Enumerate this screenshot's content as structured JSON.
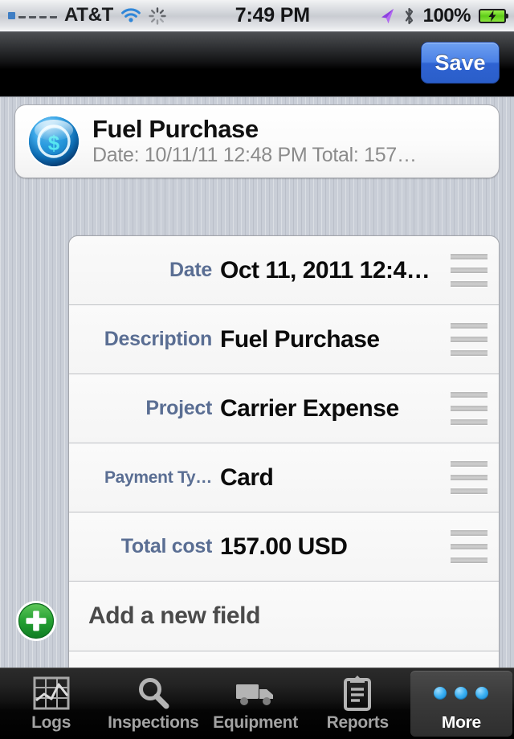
{
  "status_bar": {
    "carrier": "AT&T",
    "time": "7:49 PM",
    "battery_percent": "100%",
    "signal_bars_filled": 1,
    "signal_bars_total": 5,
    "icons": [
      "signal-bars",
      "wifi-icon",
      "activity-spinner-icon",
      "location-arrow-icon",
      "bluetooth-icon",
      "battery-charging-icon"
    ]
  },
  "nav_bar": {
    "save_label": "Save"
  },
  "summary_card": {
    "icon": "dollar-coin-icon",
    "title": "Fuel Purchase",
    "subtitle": "Date: 10/11/11 12:48 PM Total: 157…"
  },
  "fields": [
    {
      "label": "Date",
      "value": "Oct 11, 2011 12:4…",
      "label_small": false
    },
    {
      "label": "Description",
      "value": "Fuel Purchase",
      "label_small": false
    },
    {
      "label": "Project",
      "value": "Carrier Expense",
      "label_small": false
    },
    {
      "label": "Payment Ty…",
      "value": "Card",
      "label_small": true
    },
    {
      "label": "Total cost",
      "value": "157.00 USD",
      "label_small": false
    }
  ],
  "add_field_row": {
    "label": "Add a new field",
    "add_button_icon": "green-plus-circle-icon"
  },
  "tab_bar": {
    "tabs": [
      {
        "label": "Logs",
        "icon": "chart-grid-icon",
        "selected": false
      },
      {
        "label": "Inspections",
        "icon": "magnifier-icon",
        "selected": false
      },
      {
        "label": "Equipment",
        "icon": "truck-icon",
        "selected": false
      },
      {
        "label": "Reports",
        "icon": "clipboard-icon",
        "selected": false
      },
      {
        "label": "More",
        "icon": "three-dots-icon",
        "selected": true
      }
    ]
  },
  "colors": {
    "accent_blue": "#2f63d2",
    "field_label_blue": "#5a6e93",
    "add_button_green": "#2aa038",
    "background_gray": "#c9ced7"
  }
}
